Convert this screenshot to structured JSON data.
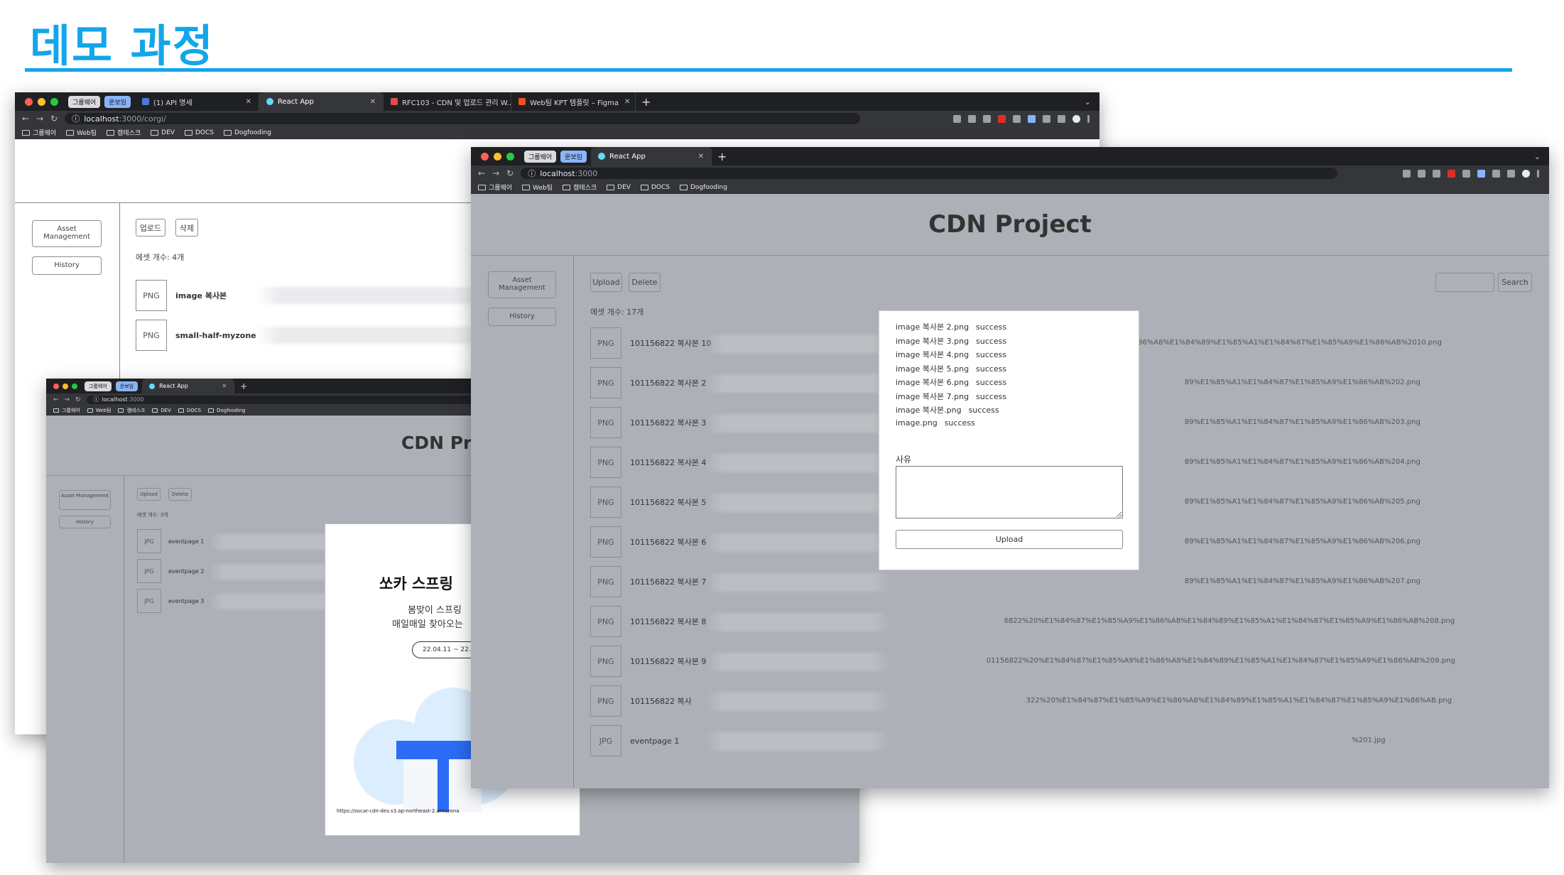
{
  "slide": {
    "title": "데모 과정"
  },
  "back_window": {
    "group_chips": [
      "그룹웨어",
      "운보임"
    ],
    "tabs": [
      {
        "label": "(1) API 명세"
      },
      {
        "label": "React App"
      },
      {
        "label": "RFC103 - CDN 및 업로드 관리 W..."
      },
      {
        "label": "Web팀 KPT 템플릿 – Figma"
      }
    ],
    "url": {
      "host": "localhost",
      "rest": ":3000/corgi/"
    },
    "bookmarks": [
      "그룹웨어",
      "Web팀",
      "캠테스크",
      "DEV",
      "DOCS",
      "Dogfooding"
    ],
    "sidebar": {
      "asset_management": "Asset Management",
      "history": "History"
    },
    "toolbar": {
      "upload": "업로드",
      "delete": "삭제"
    },
    "asset_count": "에셋 개수: 4개",
    "files": [
      {
        "type": "PNG",
        "name": "image 복사본"
      },
      {
        "type": "PNG",
        "name": "small-half-myzone"
      }
    ]
  },
  "small_window": {
    "group_chips": [
      "그룹웨어",
      "운보임"
    ],
    "tab": "React App",
    "url": {
      "host": "localhost",
      "rest": ":3000"
    },
    "bookmarks": [
      "그룹웨어",
      "Web팀",
      "캠테스크",
      "DEV",
      "DOCS",
      "Dogfooding"
    ],
    "header": "CDN Pro",
    "sidebar": {
      "asset_management": "Asset Management",
      "history": "History"
    },
    "toolbar": {
      "upload": "Upload",
      "delete": "Delete"
    },
    "asset_count": "에셋 개수: 3개",
    "files": [
      {
        "type": "JPG",
        "name": "eventpage 1"
      },
      {
        "type": "JPG",
        "name": "eventpage 2"
      },
      {
        "type": "JPG",
        "name": "eventpage 3"
      }
    ],
    "promo": {
      "headline": "쏘카 스프링 ",
      "sub1": "봄맞이 스프링 ",
      "sub2": "매일매일 찾아오는 ",
      "date": "22.04.11 ~ 22.0",
      "url": "https://socar-cdn-dev.s3.ap-northeast-2.amazona"
    }
  },
  "front_window": {
    "group_chips": [
      "그룹웨어",
      "운보임"
    ],
    "tab": "React App",
    "url": {
      "host": "localhost",
      "rest": ":3000"
    },
    "bookmarks": [
      "그룹웨어",
      "Web팀",
      "캠테스크",
      "DEV",
      "DOCS",
      "Dogfooding"
    ],
    "header": "CDN Project",
    "sidebar": {
      "asset_management": "Asset Management",
      "history": "History"
    },
    "toolbar": {
      "upload": "Upload",
      "delete": "Delete",
      "search": "Search",
      "search_placeholder": ""
    },
    "asset_count": "에셋 개수: 17개",
    "files": [
      {
        "type": "PNG",
        "name": "101156822 복사본 10",
        "url": "E1%85%A9%E1%86%A8%E1%84%89%E1%85%A1%E1%84%87%E1%85%A9%E1%86%AB%2010.png"
      },
      {
        "type": "PNG",
        "name": "101156822 복사본 2",
        "url": "89%E1%85%A1%E1%84%87%E1%85%A9%E1%86%AB%202.png"
      },
      {
        "type": "PNG",
        "name": "101156822 복사본 3",
        "url": "89%E1%85%A1%E1%84%87%E1%85%A9%E1%86%AB%203.png"
      },
      {
        "type": "PNG",
        "name": "101156822 복사본 4",
        "url": "89%E1%85%A1%E1%84%87%E1%85%A9%E1%86%AB%204.png"
      },
      {
        "type": "PNG",
        "name": "101156822 복사본 5",
        "url": "89%E1%85%A1%E1%84%87%E1%85%A9%E1%86%AB%205.png"
      },
      {
        "type": "PNG",
        "name": "101156822 복사본 6",
        "url": "89%E1%85%A1%E1%84%87%E1%85%A9%E1%86%AB%206.png"
      },
      {
        "type": "PNG",
        "name": "101156822 복사본 7",
        "url": "89%E1%85%A1%E1%84%87%E1%85%A9%E1%86%AB%207.png"
      },
      {
        "type": "PNG",
        "name": "101156822 복사본 8",
        "url": "6822%20%E1%84%87%E1%85%A9%E1%86%A8%E1%84%89%E1%85%A1%E1%84%87%E1%85%A9%E1%86%AB%208.png"
      },
      {
        "type": "PNG",
        "name": "101156822 복사본 9",
        "url": "01156822%20%E1%84%87%E1%85%A9%E1%86%A8%E1%84%89%E1%85%A1%E1%84%87%E1%85%A9%E1%86%AB%209.png"
      },
      {
        "type": "PNG",
        "name": "101156822 복사",
        "url": "322%20%E1%84%87%E1%85%A9%E1%86%A8%E1%84%89%E1%85%A1%E1%84%87%E1%85%A9%E1%86%AB.png"
      },
      {
        "type": "JPG",
        "name": "eventpage 1",
        "url": "%201.jpg"
      }
    ],
    "modal": {
      "results": [
        {
          "file": "image 복사본 2.png",
          "status": "success"
        },
        {
          "file": "image 복사본 3.png",
          "status": "success"
        },
        {
          "file": "image 복사본 4.png",
          "status": "success"
        },
        {
          "file": "image 복사본 5.png",
          "status": "success"
        },
        {
          "file": "image 복사본 6.png",
          "status": "success"
        },
        {
          "file": "image 복사본 7.png",
          "status": "success"
        },
        {
          "file": "image 복사본.png",
          "status": "success"
        },
        {
          "file": "image.png",
          "status": "success"
        }
      ],
      "reason_label": "사유",
      "upload_button": "Upload"
    }
  }
}
